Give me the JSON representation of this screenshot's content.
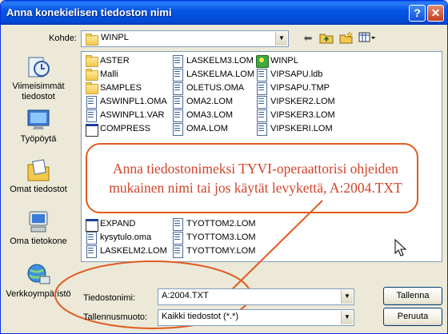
{
  "window": {
    "title": "Anna konekielisen tiedoston nimi",
    "help_label": "?",
    "close_label": "✕"
  },
  "lookin": {
    "label": "Kohde:",
    "value": "WINPL"
  },
  "places": [
    {
      "label": "Viimeisimmät tiedostot",
      "icon": "recent-documents-icon"
    },
    {
      "label": "Työpöytä",
      "icon": "desktop-icon"
    },
    {
      "label": "Omat tiedostot",
      "icon": "my-documents-icon"
    },
    {
      "label": "Oma tietokone",
      "icon": "my-computer-icon"
    },
    {
      "label": "Verkkoympäristö",
      "icon": "network-places-icon"
    }
  ],
  "files": {
    "col1": [
      {
        "name": "ASTER",
        "type": "folder"
      },
      {
        "name": "Malli",
        "type": "folder"
      },
      {
        "name": "SAMPLES",
        "type": "folder"
      },
      {
        "name": "ASWINPL1.OMA",
        "type": "doc"
      },
      {
        "name": "ASWINPL1.VAR",
        "type": "doc"
      },
      {
        "name": "COMPRESS",
        "type": "app"
      },
      {
        "name": "EXPAND",
        "type": "app"
      },
      {
        "name": "kysytulo.oma",
        "type": "doc"
      },
      {
        "name": "LASKELM2.LOM",
        "type": "doc"
      }
    ],
    "col2": [
      {
        "name": "LASKELM3.LOM",
        "type": "doc"
      },
      {
        "name": "LASKELMA.LOM",
        "type": "doc"
      },
      {
        "name": "OLETUS.OMA",
        "type": "doc"
      },
      {
        "name": "OMA2.LOM",
        "type": "doc"
      },
      {
        "name": "OMA3.LOM",
        "type": "doc"
      },
      {
        "name": "OMA.LOM",
        "type": "doc"
      },
      {
        "name": "TYOTTOM2.LOM",
        "type": "doc"
      },
      {
        "name": "TYOTTOM3.LOM",
        "type": "doc"
      },
      {
        "name": "TYOTTOMY.LOM",
        "type": "doc"
      }
    ],
    "col3": [
      {
        "name": "WINPL",
        "type": "exe"
      },
      {
        "name": "VIPSAPU.ldb",
        "type": "doc"
      },
      {
        "name": "VIPSAPU.TMP",
        "type": "doc"
      },
      {
        "name": "VIPSKER2.LOM",
        "type": "doc"
      },
      {
        "name": "VIPSKER3.LOM",
        "type": "doc"
      },
      {
        "name": "VIPSKERI.LOM",
        "type": "doc"
      }
    ]
  },
  "callout": {
    "text": "Anna tiedostonimeksi TYVI-operaattorisi ohjeiden mukainen nimi tai jos käytät levykettä, A:2004.TXT"
  },
  "filename": {
    "label": "Tiedostonimi:",
    "value": "A:2004.TXT"
  },
  "filetype": {
    "label": "Tallennusmuoto:",
    "value": "Kaikki tiedostot (*.*)"
  },
  "buttons": {
    "save": "Tallenna",
    "cancel": "Peruuta"
  },
  "colors": {
    "accent": "#e15a1f",
    "callout_text": "#d0452c",
    "title_bar": "#0348d4"
  }
}
